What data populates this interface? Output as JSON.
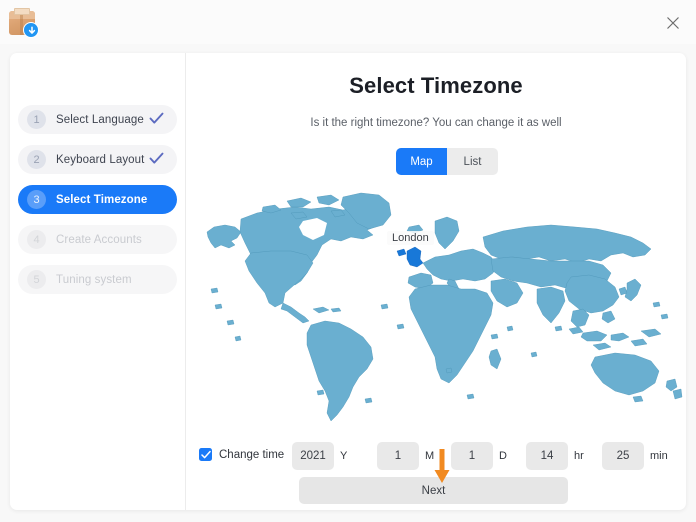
{
  "window": {
    "app_icon": "package-download-icon",
    "close_icon": "close-icon"
  },
  "sidebar": {
    "items": [
      {
        "number": "1",
        "label": "Select Language",
        "state": "done",
        "check_icon": "check-icon"
      },
      {
        "number": "2",
        "label": "Keyboard Layout",
        "state": "done",
        "check_icon": "check-icon"
      },
      {
        "number": "3",
        "label": "Select Timezone",
        "state": "active",
        "check_icon": ""
      },
      {
        "number": "4",
        "label": "Create Accounts",
        "state": "muted",
        "check_icon": ""
      },
      {
        "number": "5",
        "label": "Tuning system",
        "state": "muted",
        "check_icon": ""
      }
    ]
  },
  "main": {
    "title": "Select Timezone",
    "subtitle": "Is it the right timezone? You can change it as well",
    "view_toggle": {
      "options": [
        "Map",
        "List"
      ],
      "selected": "Map"
    },
    "map": {
      "selected_city": "London",
      "land_color": "#6aafd0",
      "highlight_color": "#1878d8",
      "border_color": "#5a9cbc"
    }
  },
  "bottom": {
    "change_time": {
      "label": "Change time",
      "checked": true,
      "checkbox_icon": "check-icon",
      "accent": "#1a7af8"
    },
    "fields": [
      {
        "name": "year",
        "value": "2021",
        "unit": "Y"
      },
      {
        "name": "month",
        "value": "1",
        "unit": "M"
      },
      {
        "name": "day",
        "value": "1",
        "unit": "D"
      },
      {
        "name": "hour",
        "value": "14",
        "unit": "hr"
      },
      {
        "name": "minute",
        "value": "25",
        "unit": "min"
      }
    ],
    "next_label": "Next",
    "annotation_arrow": {
      "icon": "down-arrow-annotation",
      "color": "#f18a21",
      "points_to": "Next"
    }
  }
}
